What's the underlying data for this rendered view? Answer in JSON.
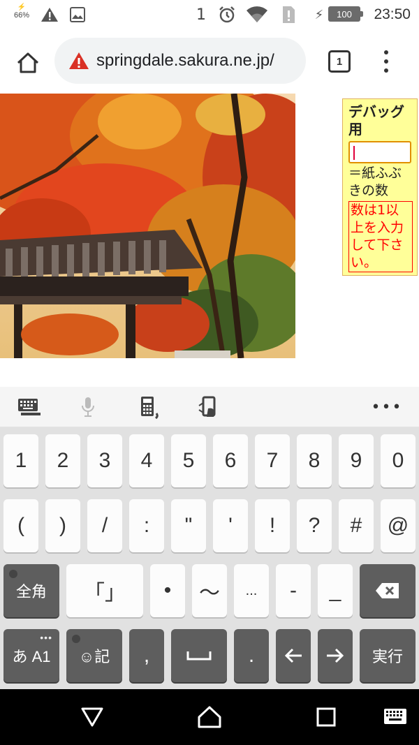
{
  "status_bar": {
    "battery_saver_text": "66%",
    "battery_level": "100",
    "time": "23:50",
    "signal_digit": "1"
  },
  "browser": {
    "url": "springdale.sakura.ne.jp/",
    "tab_count": "1"
  },
  "debug_panel": {
    "title": "デバッグ用",
    "input_value": "",
    "label": "＝紙ふぶきの数",
    "error": "数は1以上を入力して下さい。"
  },
  "keyboard": {
    "row1": [
      "1",
      "2",
      "3",
      "4",
      "5",
      "6",
      "7",
      "8",
      "9",
      "0"
    ],
    "row2": [
      "(",
      ")",
      "/",
      ":",
      "\"",
      "'",
      "!",
      "?",
      "#",
      "@"
    ],
    "row3": {
      "full_width_key": "全角",
      "symbols": [
        "「",
        "」",
        "•",
        "〜",
        "...",
        "-",
        "_"
      ]
    },
    "row4": {
      "mode_key": "あ A1",
      "emoji_key": "☺記",
      "comma": ",",
      "space": "␣",
      "period": ".",
      "enter_key": "実行"
    }
  },
  "colors": {
    "accent_warning": "#d93025",
    "debug_bg": "#ffff99",
    "error_red": "#ff0000",
    "key_dark": "#5e5e5e"
  }
}
